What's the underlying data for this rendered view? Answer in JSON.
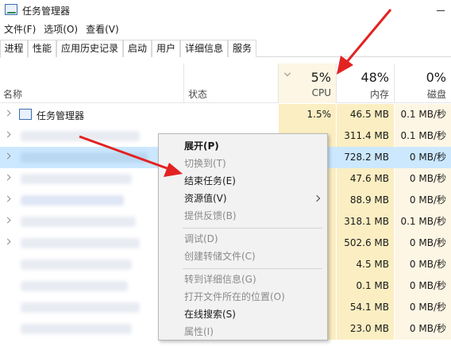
{
  "window": {
    "title": "任务管理器"
  },
  "menubar": [
    "文件(F)",
    "选项(O)",
    "查看(V)"
  ],
  "tabs": [
    "进程",
    "性能",
    "应用历史记录",
    "启动",
    "用户",
    "详细信息",
    "服务"
  ],
  "columns": {
    "name": "名称",
    "status": "状态",
    "cpu": {
      "pct": "5%",
      "label": "CPU"
    },
    "mem": {
      "pct": "48%",
      "label": "内存"
    },
    "disk": {
      "pct": "0%",
      "label": "磁盘"
    }
  },
  "rows": [
    {
      "name": "任务管理器",
      "cpu": "1.5%",
      "mem": "46.5 MB",
      "disk": "0.1 MB/秒"
    },
    {
      "name": "",
      "cpu": "",
      "mem": "311.4 MB",
      "disk": "0.1 MB/秒"
    },
    {
      "name": "",
      "cpu": "",
      "mem": "728.2 MB",
      "disk": "0 MB/秒"
    },
    {
      "name": "",
      "cpu": "",
      "mem": "47.6 MB",
      "disk": "0 MB/秒"
    },
    {
      "name": "",
      "cpu": "",
      "mem": "88.9 MB",
      "disk": "0 MB/秒"
    },
    {
      "name": "",
      "cpu": "",
      "mem": "318.1 MB",
      "disk": "0.1 MB/秒"
    },
    {
      "name": "",
      "cpu": "",
      "mem": "502.6 MB",
      "disk": "0 MB/秒"
    },
    {
      "name": "",
      "cpu": "",
      "mem": "4.5 MB",
      "disk": "0 MB/秒"
    },
    {
      "name": "",
      "cpu": "",
      "mem": "0.1 MB",
      "disk": "0 MB/秒"
    },
    {
      "name": "",
      "cpu": "",
      "mem": "54.1 MB",
      "disk": "0 MB/秒"
    },
    {
      "name": "",
      "cpu": "",
      "mem": "23.0 MB",
      "disk": "0 MB/秒"
    }
  ],
  "context_menu": {
    "items": [
      "展开(P)",
      "切换到(T)",
      "结束任务(E)",
      "资源值(V)",
      "提供反馈(B)",
      "调试(D)",
      "创建转储文件(C)",
      "转到详细信息(G)",
      "打开文件所在的位置(O)",
      "在线搜索(S)",
      "属性(I)"
    ]
  },
  "colors": {
    "arrow": "#e32222",
    "selected_row": "#cce8ff",
    "heat": "#fbeec2"
  }
}
